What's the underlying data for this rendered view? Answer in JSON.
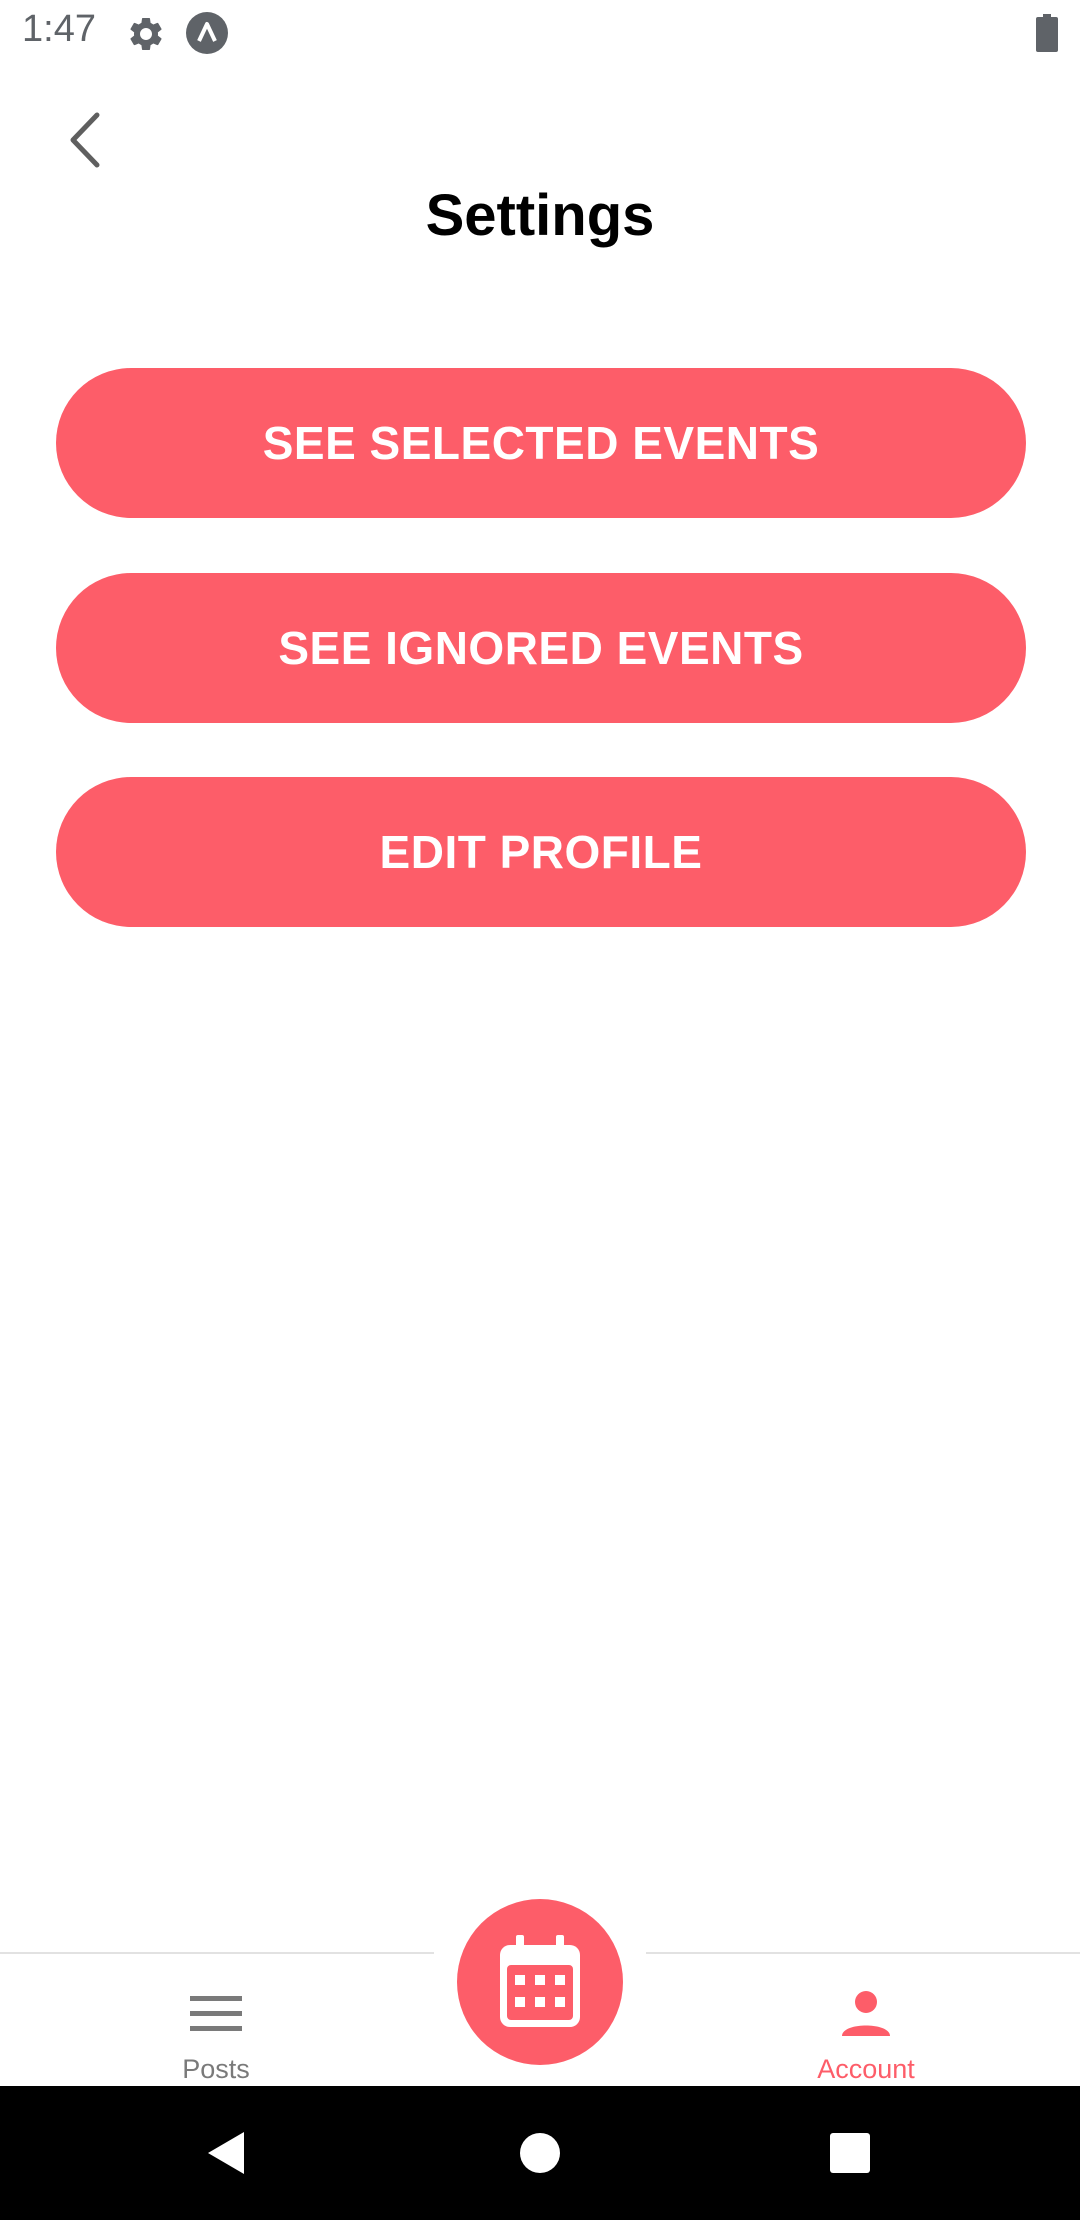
{
  "colors": {
    "accent": "#fd5d69",
    "inactive": "#7a7a7a",
    "status_icons": "#5f6368"
  },
  "status_bar": {
    "time": "1:47",
    "icons": [
      "gear-icon",
      "app-notification-icon",
      "battery-icon"
    ]
  },
  "header": {
    "back_icon": "chevron-left-icon",
    "title": "Settings"
  },
  "actions": {
    "selected_events": "SEE SELECTED EVENTS",
    "ignored_events": "SEE IGNORED EVENTS",
    "edit_profile": "EDIT PROFILE"
  },
  "bottom_nav": {
    "posts": {
      "label": "Posts",
      "icon": "menu-icon",
      "active": false
    },
    "fab": {
      "icon": "calendar-icon"
    },
    "account": {
      "label": "Account",
      "icon": "person-icon",
      "active": true
    }
  },
  "system_nav": {
    "icons": [
      "back-triangle-icon",
      "home-circle-icon",
      "recents-square-icon"
    ]
  }
}
